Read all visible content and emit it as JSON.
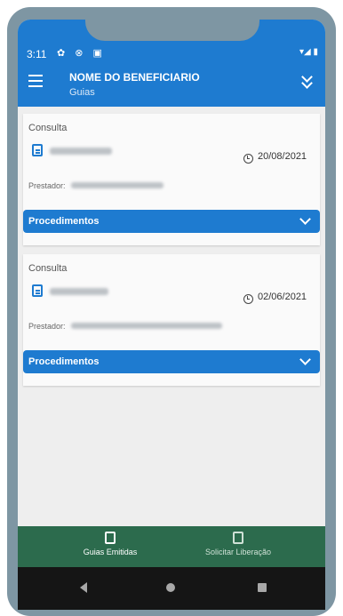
{
  "status_bar": {
    "time": "3:11",
    "left_icons": "✿ ⊗ ▣",
    "right_icons": "▾◢ ▮"
  },
  "app_bar": {
    "title": "NOME DO BENEFICIARIO",
    "subtitle": "Guias"
  },
  "guides": [
    {
      "type": "Consulta",
      "date": "20/08/2021",
      "provider_label": "Prestador:",
      "procedures_label": "Procedimentos"
    },
    {
      "type": "Consulta",
      "date": "02/06/2021",
      "provider_label": "Prestador:",
      "procedures_label": "Procedimentos"
    }
  ],
  "bottom_nav": {
    "items": [
      {
        "label": "Guias Emitidas"
      },
      {
        "label": "Solicitar Liberação"
      }
    ]
  },
  "colors": {
    "primary": "#1e7bd0",
    "bottom_nav": "#2c6b4d",
    "frame": "#7e96a3"
  }
}
